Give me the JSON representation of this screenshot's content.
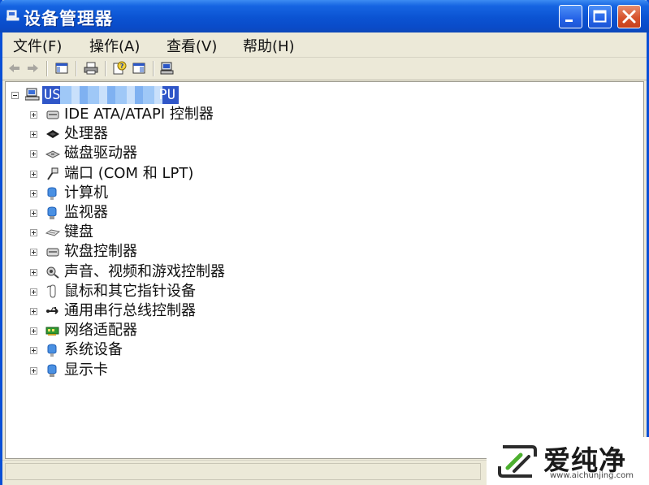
{
  "window": {
    "title": "设备管理器",
    "accent": "#0b53d2"
  },
  "menubar": {
    "items": [
      "文件(F)",
      "操作(A)",
      "查看(V)",
      "帮助(H)"
    ]
  },
  "toolbar": {
    "buttons": [
      "back-arrow-icon",
      "forward-arrow-icon",
      "console-tree-icon",
      "print-icon",
      "help-icon",
      "properties-icon",
      "scan-hardware-icon"
    ]
  },
  "tree": {
    "root": {
      "label_start": "US",
      "label_end": "PU",
      "icon": "computer-icon",
      "expanded": true
    },
    "categories": [
      {
        "label": "IDE ATA/ATAPI 控制器",
        "icon": "ide-controller-icon"
      },
      {
        "label": "处理器",
        "icon": "processor-icon"
      },
      {
        "label": "磁盘驱动器",
        "icon": "disk-drive-icon"
      },
      {
        "label": "端口 (COM 和 LPT)",
        "icon": "port-icon"
      },
      {
        "label": "计算机",
        "icon": "computer-icon"
      },
      {
        "label": "监视器",
        "icon": "monitor-icon"
      },
      {
        "label": "键盘",
        "icon": "keyboard-icon"
      },
      {
        "label": "软盘控制器",
        "icon": "floppy-controller-icon"
      },
      {
        "label": "声音、视频和游戏控制器",
        "icon": "sound-icon"
      },
      {
        "label": "鼠标和其它指针设备",
        "icon": "mouse-icon"
      },
      {
        "label": "通用串行总线控制器",
        "icon": "usb-icon"
      },
      {
        "label": "网络适配器",
        "icon": "network-adapter-icon"
      },
      {
        "label": "系统设备",
        "icon": "system-device-icon"
      },
      {
        "label": "显示卡",
        "icon": "display-adapter-icon"
      }
    ]
  },
  "watermark": {
    "brand": "爱纯净",
    "url": "www.aichunjing.com"
  }
}
